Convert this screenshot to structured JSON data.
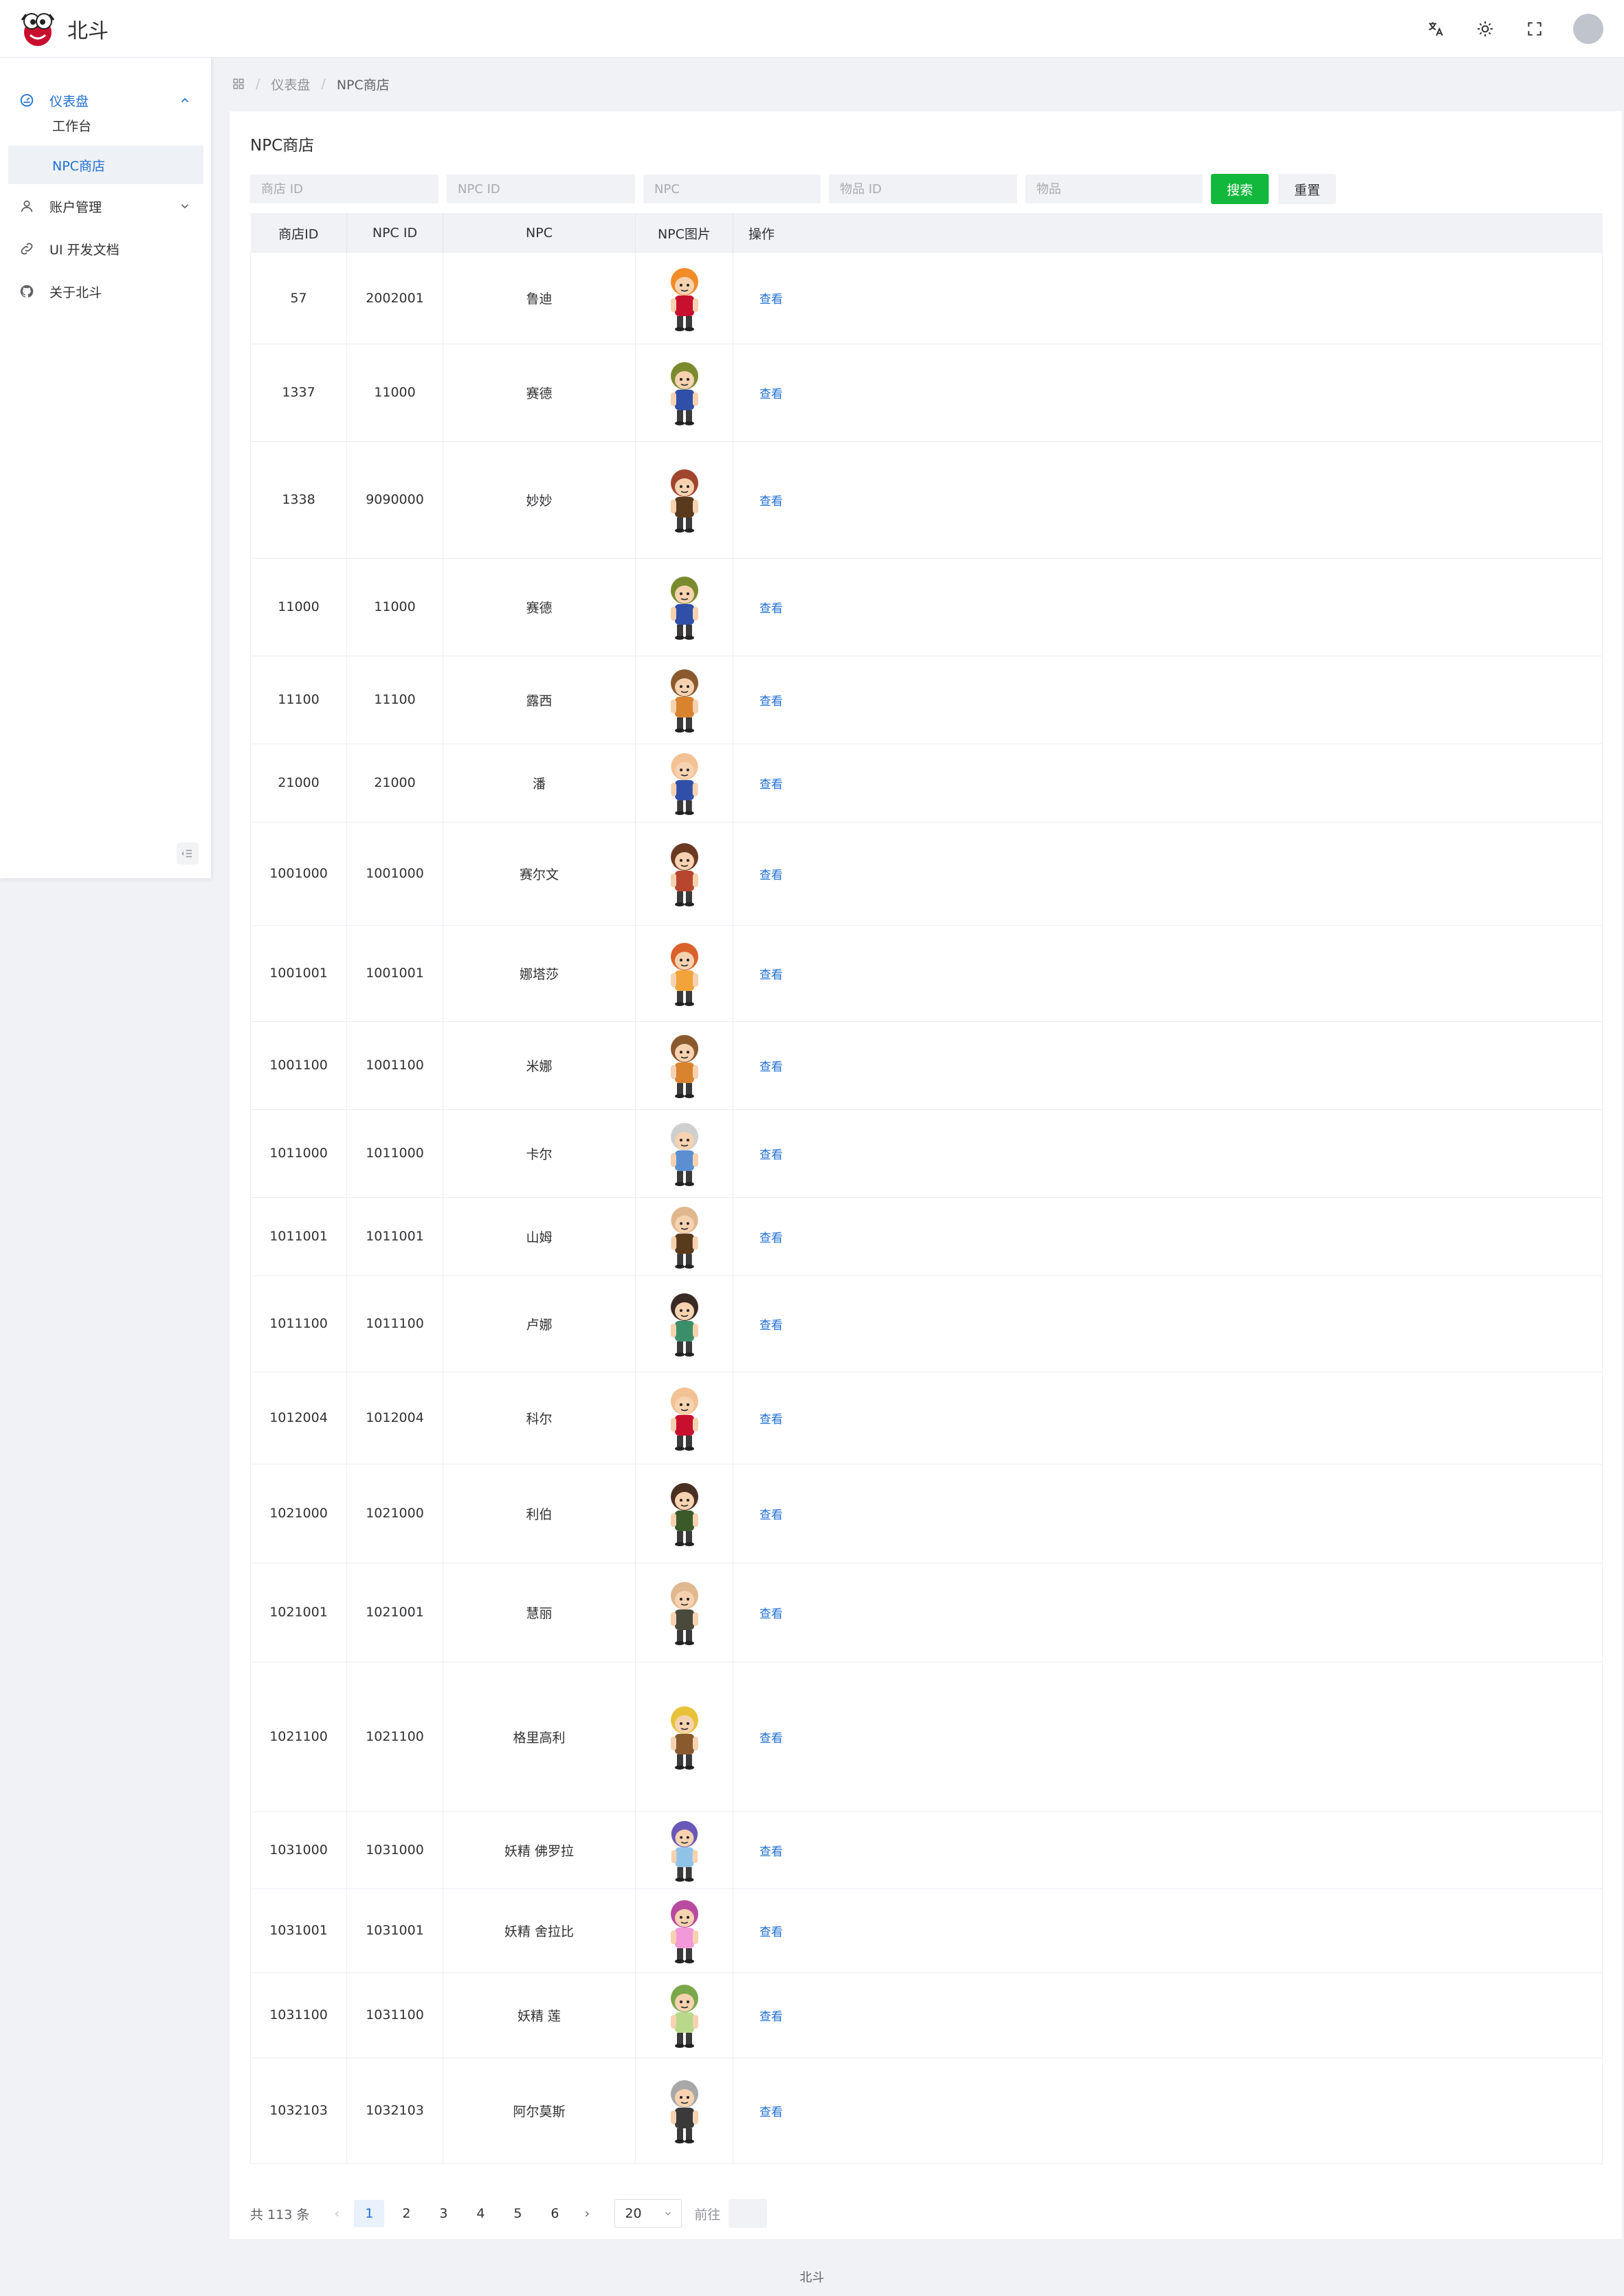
{
  "app": {
    "name": "北斗"
  },
  "header": {
    "icons": [
      "translate-icon",
      "theme-toggle-icon",
      "fullscreen-icon",
      "user-avatar"
    ]
  },
  "sidebar": {
    "items": [
      {
        "label": "仪表盘",
        "icon": "dashboard-icon",
        "expanded": true
      },
      {
        "label": "工作台"
      },
      {
        "label": "NPC商店",
        "active": true
      },
      {
        "label": "账户管理",
        "icon": "user-icon",
        "expanded": false
      },
      {
        "label": "UI 开发文档",
        "icon": "link-icon"
      },
      {
        "label": "关于北斗",
        "icon": "github-icon"
      }
    ]
  },
  "breadcrumb": {
    "home_icon": "grid-icon",
    "level1": "仪表盘",
    "level2": "NPC商店"
  },
  "page": {
    "title": "NPC商店"
  },
  "search": {
    "shop_id_placeholder": "商店 ID",
    "npc_id_placeholder": "NPC ID",
    "npc_placeholder": "NPC",
    "item_id_placeholder": "物品 ID",
    "item_placeholder": "物品",
    "search_label": "搜索",
    "reset_label": "重置",
    "accent_color": "#12b83c"
  },
  "table": {
    "headers": [
      "商店ID",
      "NPC ID",
      "NPC",
      "NPC图片",
      "操作"
    ],
    "action_label": "查看",
    "rows": [
      {
        "shop_id": "57",
        "npc_id": "2002001",
        "npc": "鲁迪"
      },
      {
        "shop_id": "1337",
        "npc_id": "11000",
        "npc": "赛德"
      },
      {
        "shop_id": "1338",
        "npc_id": "9090000",
        "npc": "妙妙"
      },
      {
        "shop_id": "11000",
        "npc_id": "11000",
        "npc": "赛德"
      },
      {
        "shop_id": "11100",
        "npc_id": "11100",
        "npc": "露西"
      },
      {
        "shop_id": "21000",
        "npc_id": "21000",
        "npc": "潘"
      },
      {
        "shop_id": "1001000",
        "npc_id": "1001000",
        "npc": "赛尔文"
      },
      {
        "shop_id": "1001001",
        "npc_id": "1001001",
        "npc": "娜塔莎"
      },
      {
        "shop_id": "1001100",
        "npc_id": "1001100",
        "npc": "米娜"
      },
      {
        "shop_id": "1011000",
        "npc_id": "1011000",
        "npc": "卡尔"
      },
      {
        "shop_id": "1011001",
        "npc_id": "1011001",
        "npc": "山姆"
      },
      {
        "shop_id": "1011100",
        "npc_id": "1011100",
        "npc": "卢娜"
      },
      {
        "shop_id": "1012004",
        "npc_id": "1012004",
        "npc": "科尔"
      },
      {
        "shop_id": "1021000",
        "npc_id": "1021000",
        "npc": "利伯"
      },
      {
        "shop_id": "1021001",
        "npc_id": "1021001",
        "npc": "慧丽"
      },
      {
        "shop_id": "1021100",
        "npc_id": "1021100",
        "npc": "格里高利"
      },
      {
        "shop_id": "1031000",
        "npc_id": "1031000",
        "npc": "妖精 佛罗拉"
      },
      {
        "shop_id": "1031001",
        "npc_id": "1031001",
        "npc": "妖精 舍拉比"
      },
      {
        "shop_id": "1031100",
        "npc_id": "1031100",
        "npc": "妖精 莲"
      },
      {
        "shop_id": "1032103",
        "npc_id": "1032103",
        "npc": "阿尔莫斯"
      }
    ]
  },
  "pagination": {
    "total_label": "共 113 条",
    "pages": [
      "1",
      "2",
      "3",
      "4",
      "5",
      "6"
    ],
    "current": "1",
    "page_size": "20",
    "goto_label": "前往"
  },
  "footer": {
    "text": "北斗"
  }
}
